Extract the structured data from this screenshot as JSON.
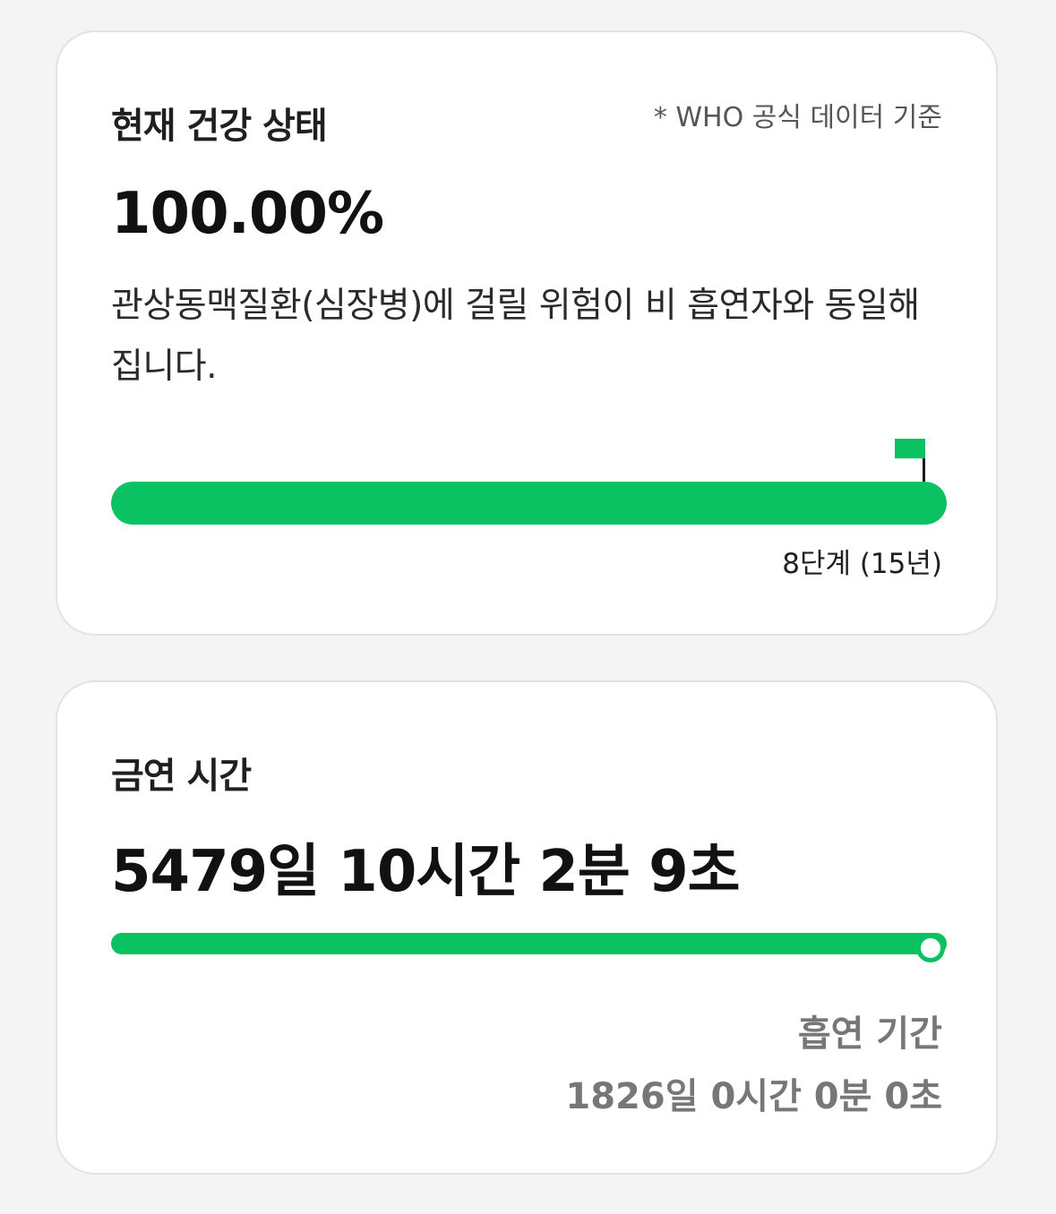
{
  "colors": {
    "accent": "#0bc262",
    "background": "#f4f4f4",
    "card": "#ffffff",
    "muted_text": "#777777"
  },
  "health": {
    "title": "현재 건강 상태",
    "source_note": "* WHO 공식 데이터 기준",
    "percent_text": "100.00%",
    "description": "관상동맥질환(심장병)에 걸릴 위험이 비 흡연자와 동일해집니다.",
    "progress_fraction": 1.0,
    "stage_label": "8단계 (15년)",
    "goal_icon": "flag-icon"
  },
  "quit_time": {
    "title": "금연 시간",
    "value": "5479일 10시간 2분 9초",
    "progress_fraction": 0.975,
    "smoking_label": "흡연 기간",
    "smoking_value": "1826일 0시간 0분 0초"
  }
}
